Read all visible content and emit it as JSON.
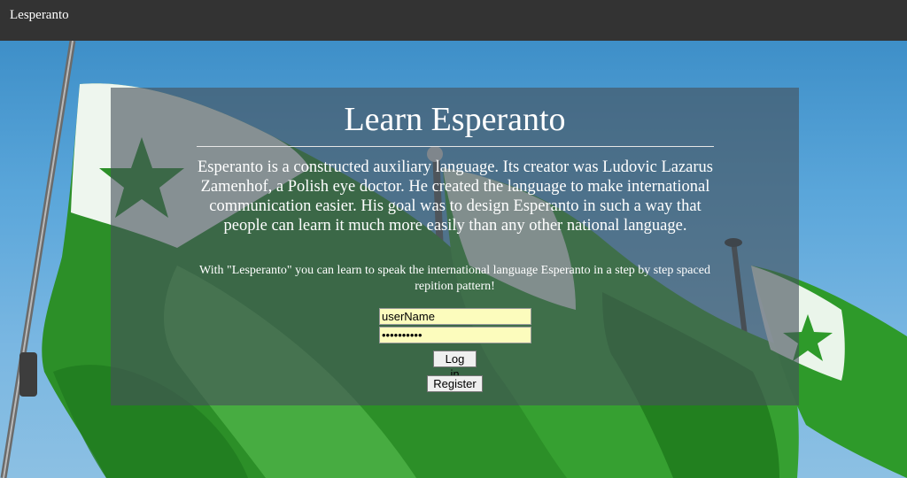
{
  "navbar": {
    "brand": "Lesperanto"
  },
  "hero": {
    "title": "Learn Esperanto",
    "intro": "Esperanto is a constructed auxiliary language. Its creator was Ludovic Lazarus Zamenhof, a Polish eye doctor. He created the language to make international communication easier. His goal was to design Esperanto in such a way that people can learn it much more easily than any other national language.",
    "subtitle": "With \"Lesperanto\" you can learn to speak the international language Esperanto in a step by step spaced repition pattern!"
  },
  "login_form": {
    "username_value": "userName",
    "password_value": "••••••••••",
    "login_label": "Log in",
    "register_label": "Register"
  },
  "colors": {
    "navbar_bg": "#333333",
    "panel_bg": "rgba(70,80,90,0.62)",
    "input_bg": "#fcfcbd",
    "flag_green": "#2f9a2c",
    "sky": "#5aa6da"
  }
}
